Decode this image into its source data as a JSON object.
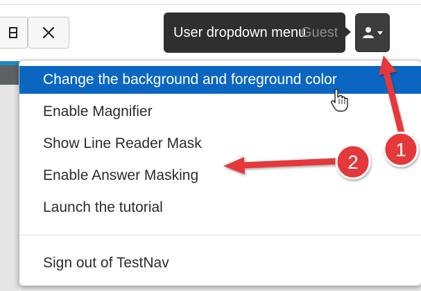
{
  "toolbar": {
    "close_icon": "close-icon",
    "partial_icon": "grid-icon"
  },
  "user_button": {
    "icon": "user-icon",
    "caret": "caret-down-icon"
  },
  "tooltip": {
    "text": "User dropdown menu",
    "behind_text": "Guest"
  },
  "menu": {
    "items": [
      {
        "label": "Change the background and foreground color"
      },
      {
        "label": "Enable Magnifier"
      },
      {
        "label": "Show Line Reader Mask"
      },
      {
        "label": "Enable Answer Masking"
      },
      {
        "label": "Launch the tutorial"
      }
    ],
    "signout": {
      "label": "Sign out of TestNav"
    }
  },
  "annotations": {
    "badge_1": "1",
    "badge_2": "2"
  },
  "colors": {
    "highlight": "#0b66c2",
    "annotation_red": "#e5393b",
    "tooltip_bg": "#2f2f2f",
    "header_blue": "#1f88c9"
  }
}
